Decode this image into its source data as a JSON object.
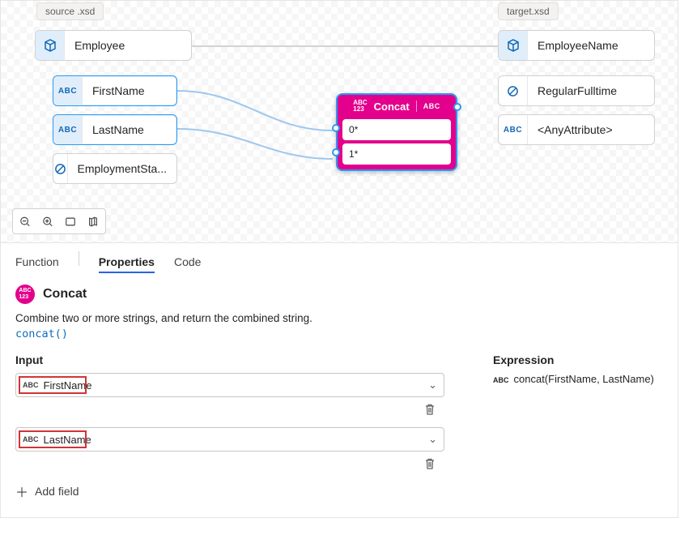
{
  "source_file": "source .xsd",
  "target_file": "target.xsd",
  "source": {
    "root": "Employee",
    "children": [
      "FirstName",
      "LastName",
      "EmploymentSta..."
    ]
  },
  "target": {
    "root": "EmployeeName",
    "children": [
      "RegularFulltime",
      "<AnyAttribute>"
    ]
  },
  "func": {
    "name": "Concat",
    "slot0": "0*",
    "slot1": "1*"
  },
  "tabs": {
    "function": "Function",
    "properties": "Properties",
    "code": "Code"
  },
  "panel": {
    "title": "Concat",
    "desc": "Combine two or more strings, and return the combined string.",
    "signature": "concat()",
    "input_label": "Input",
    "inputs": [
      "FirstName",
      "LastName"
    ],
    "add_field": "Add field",
    "expression_label": "Expression",
    "expression": "concat(FirstName, LastName)"
  }
}
